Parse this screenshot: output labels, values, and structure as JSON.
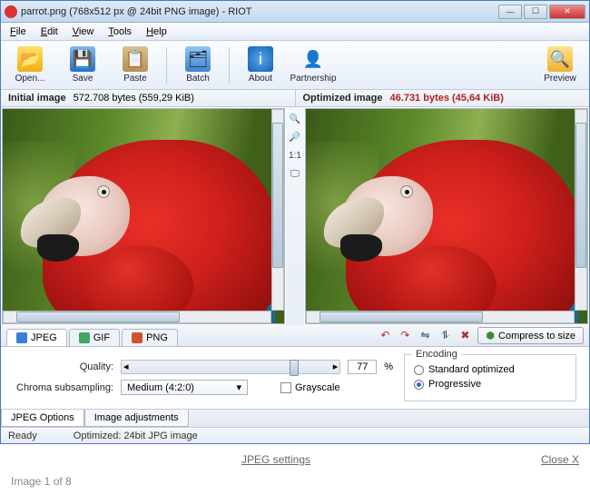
{
  "window": {
    "title": "parrot.png (768x512 px @ 24bit PNG image) - RIOT"
  },
  "menu": {
    "file": "File",
    "edit": "Edit",
    "view": "View",
    "tools": "Tools",
    "help": "Help"
  },
  "toolbar": {
    "open": "Open...",
    "save": "Save",
    "paste": "Paste",
    "batch": "Batch",
    "about": "About",
    "partnership": "Partnership",
    "preview": "Preview"
  },
  "info": {
    "initial_label": "Initial image",
    "initial_value": "572.708 bytes (559,29 KiB)",
    "optimized_label": "Optimized image",
    "optimized_value": "46.731 bytes (45,64 KiB)"
  },
  "side_tools": {
    "zoom_in": "zoom-in",
    "zoom_out": "zoom-out",
    "fit": "1:1",
    "monitor": "monitor"
  },
  "format_tabs": {
    "jpeg": "JPEG",
    "gif": "GIF",
    "png": "PNG"
  },
  "right_tools": {
    "compress": "Compress to size"
  },
  "settings": {
    "quality_label": "Quality:",
    "quality_value": "77",
    "quality_pct": "%",
    "chroma_label": "Chroma subsampling:",
    "chroma_value": "Medium (4:2:0)",
    "grayscale": "Grayscale",
    "encoding_legend": "Encoding",
    "standard": "Standard optimized",
    "progressive": "Progressive"
  },
  "bottom_tabs": {
    "jpeg_options": "JPEG Options",
    "image_adj": "Image adjustments"
  },
  "status": {
    "ready": "Ready",
    "optimized": "Optimized: 24bit JPG image"
  },
  "footer": {
    "title": "JPEG settings",
    "close": "Close X",
    "page": "Image 1 of 8"
  }
}
